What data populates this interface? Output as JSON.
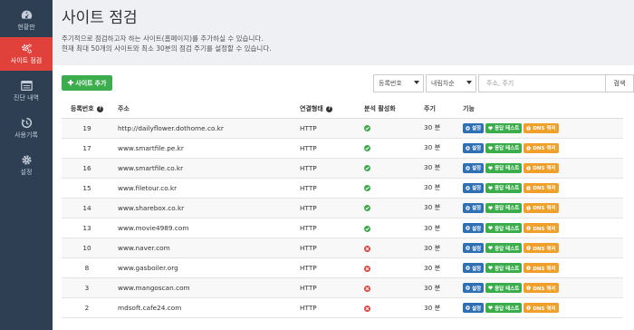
{
  "sidebar": {
    "items": [
      {
        "label": "현황판",
        "icon": "dashboard-icon"
      },
      {
        "label": "사이트 점검",
        "icon": "gears-icon"
      },
      {
        "label": "진단 내역",
        "icon": "list-icon"
      },
      {
        "label": "사용기록",
        "icon": "history-icon"
      },
      {
        "label": "설정",
        "icon": "gear-icon"
      }
    ],
    "active_index": 1,
    "active_color": "#e0413a"
  },
  "header": {
    "title": "사이트 점검",
    "desc_line1": "주기적으로 점검하고자 하는 사이트(홈페이지)를 추가하실 수 있습니다.",
    "desc_line2": "현재 최대 50개의 사이트와 최소 30분의 점검 주기를 설정할 수 있습니다."
  },
  "toolbar": {
    "add_label": "사이트 추가",
    "sort_field": "등록번호",
    "sort_order": "내림차순",
    "search_placeholder": "주소, 주기",
    "search_label": "검색"
  },
  "table": {
    "columns": [
      "등록번호",
      "주소",
      "연결형태",
      "분석 활성화",
      "주기",
      "기능"
    ],
    "rows": [
      {
        "id": "19",
        "url": "http://dailyflower.dothome.co.kr",
        "conn": "HTTP",
        "active": true,
        "period": "30 분"
      },
      {
        "id": "17",
        "url": "www.smartfile.pe.kr",
        "conn": "HTTP",
        "active": true,
        "period": "30 분"
      },
      {
        "id": "16",
        "url": "www.smartfile.co.kr",
        "conn": "HTTP",
        "active": true,
        "period": "30 분"
      },
      {
        "id": "15",
        "url": "www.filetour.co.kr",
        "conn": "HTTP",
        "active": true,
        "period": "30 분"
      },
      {
        "id": "14",
        "url": "www.sharebox.co.kr",
        "conn": "HTTP",
        "active": true,
        "period": "30 분"
      },
      {
        "id": "13",
        "url": "www.movie4989.com",
        "conn": "HTTP",
        "active": true,
        "period": "30 분"
      },
      {
        "id": "10",
        "url": "www.naver.com",
        "conn": "HTTP",
        "active": false,
        "period": "30 분"
      },
      {
        "id": "8",
        "url": "www.gasboiler.org",
        "conn": "HTTP",
        "active": false,
        "period": "30 분"
      },
      {
        "id": "3",
        "url": "www.mangoscan.com",
        "conn": "HTTP",
        "active": false,
        "period": "30 분"
      },
      {
        "id": "2",
        "url": "mdsoft.cafe24.com",
        "conn": "HTTP",
        "active": false,
        "period": "30 분"
      }
    ],
    "actions": {
      "settings": "설정",
      "response_test": "응답 테스트",
      "dns_query": "DNS 쿼리"
    }
  }
}
